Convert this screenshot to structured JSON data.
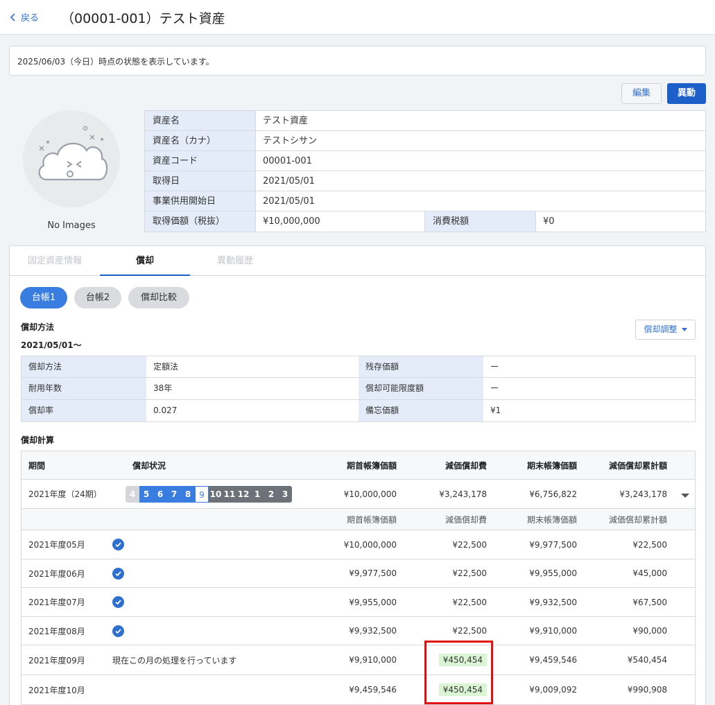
{
  "header": {
    "back_label": "戻る",
    "title": "（00001-001）テスト資産"
  },
  "notice": "2025/06/03（今日）時点の状態を表示しています。",
  "actions": {
    "edit": "編集",
    "move": "異動"
  },
  "image": {
    "empty_label": "No Images"
  },
  "asset": {
    "name_label": "資産名",
    "name": "テスト資産",
    "kana_label": "資産名（カナ）",
    "kana": "テストシサン",
    "code_label": "資産コード",
    "code": "00001-001",
    "acq_date_label": "取得日",
    "acq_date": "2021/05/01",
    "use_date_label": "事業供用開始日",
    "use_date": "2021/05/01",
    "price_label": "取得価額（税抜）",
    "price": "¥10,000,000",
    "tax_label": "消費税額",
    "tax": "¥0"
  },
  "tabs": [
    "固定資産情報",
    "償却",
    "異動履歴"
  ],
  "ledgers": [
    "台帳1",
    "台帳2",
    "償却比較"
  ],
  "method_section": {
    "title": "償却方法",
    "date": "2021/05/01〜",
    "adjust": "償却調整"
  },
  "method": {
    "method_label": "償却方法",
    "method": "定額法",
    "years_label": "耐用年数",
    "years": "38年",
    "rate_label": "償却率",
    "rate": "0.027",
    "residual_label": "残存価額",
    "residual": "ー",
    "limit_label": "償却可能限度額",
    "limit": "ー",
    "memo_label": "備忘価額",
    "memo": "¥1"
  },
  "calc": {
    "title": "償却計算",
    "headers": {
      "period": "期間",
      "status": "償却状況",
      "begin": "期首帳簿価額",
      "dep": "減価償却費",
      "end": "期末帳簿価額",
      "cum": "減価償却累計額"
    },
    "year": {
      "label": "2021年度（24期）",
      "begin": "¥10,000,000",
      "dep": "¥3,243,178",
      "end": "¥6,756,822",
      "cum": "¥3,243,178"
    },
    "months": [
      {
        "label": "4",
        "state": "done"
      },
      {
        "label": "5",
        "state": "proc"
      },
      {
        "label": "6",
        "state": "proc"
      },
      {
        "label": "7",
        "state": "proc"
      },
      {
        "label": "8",
        "state": "proc"
      },
      {
        "label": "9",
        "state": "cur"
      },
      {
        "label": "10",
        "state": "fut"
      },
      {
        "label": "11",
        "state": "fut"
      },
      {
        "label": "12",
        "state": "fut"
      },
      {
        "label": "1",
        "state": "fut"
      },
      {
        "label": "2",
        "state": "fut"
      },
      {
        "label": "3",
        "state": "fut"
      }
    ],
    "rows": [
      {
        "period": "2021年度05月",
        "checked": true,
        "status": "",
        "begin": "¥10,000,000",
        "dep": "¥22,500",
        "end": "¥9,977,500",
        "cum": "¥22,500"
      },
      {
        "period": "2021年度06月",
        "checked": true,
        "status": "",
        "begin": "¥9,977,500",
        "dep": "¥22,500",
        "end": "¥9,955,000",
        "cum": "¥45,000"
      },
      {
        "period": "2021年度07月",
        "checked": true,
        "status": "",
        "begin": "¥9,955,000",
        "dep": "¥22,500",
        "end": "¥9,932,500",
        "cum": "¥67,500"
      },
      {
        "period": "2021年度08月",
        "checked": true,
        "status": "",
        "begin": "¥9,932,500",
        "dep": "¥22,500",
        "end": "¥9,910,000",
        "cum": "¥90,000"
      },
      {
        "period": "2021年度09月",
        "checked": false,
        "status": "現在この月の処理を行っています",
        "begin": "¥9,910,000",
        "dep": "¥450,454",
        "end": "¥9,459,546",
        "cum": "¥540,454",
        "highlight": true
      },
      {
        "period": "2021年度10月",
        "checked": false,
        "status": "",
        "begin": "¥9,459,546",
        "dep": "¥450,454",
        "end": "¥9,009,092",
        "cum": "¥990,908",
        "highlight": true
      }
    ]
  },
  "colors": {
    "accent": "#1c5fc8",
    "highlight_bg": "#d9f5d3",
    "annotation": "#e01010"
  },
  "icons": [
    "chevron-left-icon",
    "no-image-cloud-icon",
    "check-circle-icon",
    "caret-down-icon"
  ]
}
